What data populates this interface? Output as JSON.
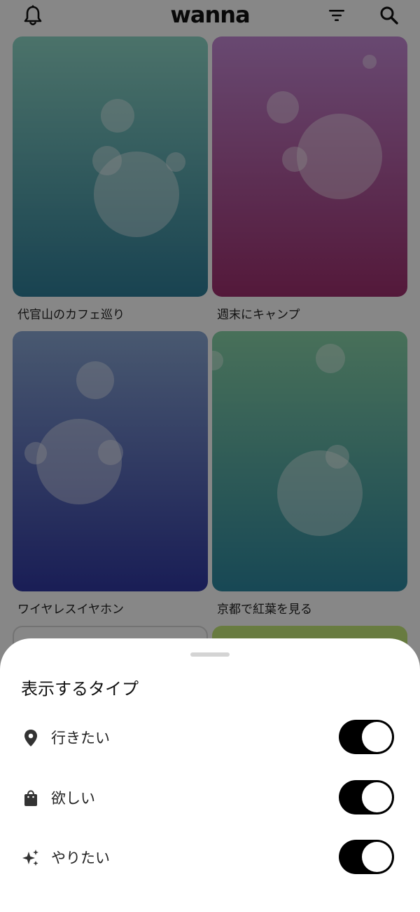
{
  "header": {
    "logo_text": "wanna",
    "icons": [
      "bell-icon",
      "filter-icon",
      "search-icon"
    ]
  },
  "cards": [
    {
      "title": "代官山のカフェ巡り",
      "colors": [
        "#8fd8c8",
        "#2f7e99"
      ]
    },
    {
      "title": "週末にキャンプ",
      "colors": [
        "#c58ad6",
        "#9e2f6e"
      ]
    },
    {
      "title": "ワイヤレスイヤホン",
      "colors": [
        "#8aa8d4",
        "#3038a2"
      ]
    },
    {
      "title": "京都で紅葉を見る",
      "colors": [
        "#89d4a9",
        "#2d88a0"
      ]
    },
    {
      "title": "",
      "colors": [
        "#ffffff"
      ]
    },
    {
      "title": "",
      "colors": [
        "#c6ea7a",
        "#8ec45a"
      ]
    }
  ],
  "sheet": {
    "title": "表示するタイプ",
    "options": [
      {
        "label": "行きたい",
        "icon": "location-pin-icon",
        "enabled": true
      },
      {
        "label": "欲しい",
        "icon": "shopping-bag-icon",
        "enabled": true
      },
      {
        "label": "やりたい",
        "icon": "sparkles-icon",
        "enabled": true
      }
    ]
  },
  "colors": {
    "overlay": "#000000",
    "toggle_on": "#000000",
    "sheet_background": "#ffffff"
  }
}
